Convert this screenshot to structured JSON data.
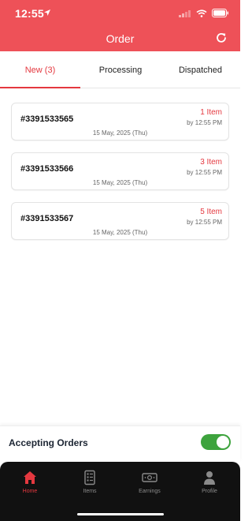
{
  "status_bar": {
    "time": "12:55"
  },
  "header": {
    "title": "Order",
    "refresh_icon": "refresh-icon"
  },
  "tabs": [
    {
      "label": "New (3)",
      "active": true
    },
    {
      "label": "Processing",
      "active": false
    },
    {
      "label": "Dispatched",
      "active": false
    }
  ],
  "orders": [
    {
      "id": "#3391533565",
      "items": "1 Item",
      "time": "by 12:55 PM",
      "date": "15 May, 2025 (Thu)"
    },
    {
      "id": "#3391533566",
      "items": "3 Item",
      "time": "by 12:55 PM",
      "date": "15 May, 2025 (Thu)"
    },
    {
      "id": "#3391533567",
      "items": "5 Item",
      "time": "by 12:55 PM",
      "date": "15 May, 2025 (Thu)"
    }
  ],
  "accepting": {
    "label": "Accepting Orders",
    "enabled": true
  },
  "nav": [
    {
      "label": "Home",
      "icon": "home-icon",
      "active": true
    },
    {
      "label": "Items",
      "icon": "items-icon",
      "active": false
    },
    {
      "label": "Earnings",
      "icon": "earnings-icon",
      "active": false
    },
    {
      "label": "Profile",
      "icon": "profile-icon",
      "active": false
    }
  ],
  "colors": {
    "brand": "#ee5158",
    "accent": "#e4383f",
    "toggle_on": "#3da33d",
    "nav_bg": "#111111"
  }
}
